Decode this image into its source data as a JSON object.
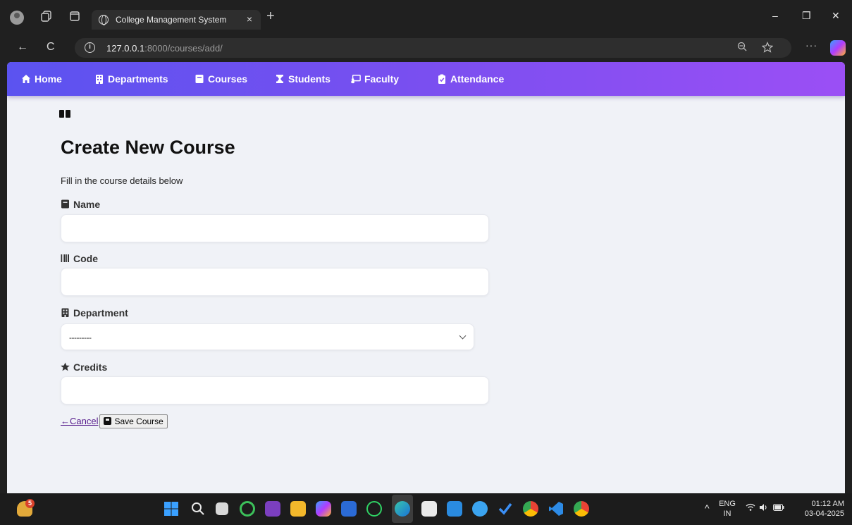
{
  "browser": {
    "tab_title": "College Management System",
    "tab_close": "×",
    "new_tab": "+",
    "url_host": "127.0.0.1",
    "url_path": ":8000/courses/add/",
    "win_minimize": "–",
    "win_restore": "❐",
    "win_close": "✕",
    "back": "←",
    "reload": "C",
    "more": "···"
  },
  "navbar": {
    "items": [
      {
        "label": "Home",
        "icon": "home-icon"
      },
      {
        "label": "Departments",
        "icon": "building-icon"
      },
      {
        "label": "Courses",
        "icon": "book-icon"
      },
      {
        "label": "Students",
        "icon": "graduation-icon"
      },
      {
        "label": "Faculty",
        "icon": "chalkboard-icon"
      },
      {
        "label": "Attendance",
        "icon": "clipboard-icon"
      }
    ]
  },
  "page": {
    "title": "Create New Course",
    "subtitle": "Fill in the course details below"
  },
  "form": {
    "name_label": "Name",
    "name_value": "",
    "code_label": "Code",
    "code_value": "",
    "department_label": "Department",
    "department_selected": "---------",
    "credits_label": "Credits",
    "credits_value": "",
    "cancel_label": "Cancel",
    "cancel_arrow": "←",
    "save_label": "Save Course"
  },
  "taskbar": {
    "notification_badge": "5",
    "language_top": "ENG",
    "language_bottom": "IN",
    "time": "01:12 AM",
    "date": "03-04-2025",
    "tray_chevron": "^"
  },
  "colors": {
    "navbar_start": "#5b53f0",
    "navbar_end": "#9b4ff5",
    "page_bg": "#f0f2f7",
    "link_visited": "#551a8b"
  }
}
